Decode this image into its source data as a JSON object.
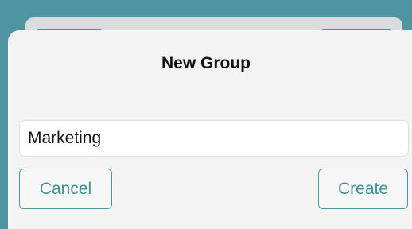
{
  "dialog": {
    "title": "New Group",
    "group_name_value": "Marketing",
    "cancel_label": "Cancel",
    "create_label": "Create"
  },
  "colors": {
    "accent": "#4e95a1",
    "background": "#f3f3f3"
  }
}
